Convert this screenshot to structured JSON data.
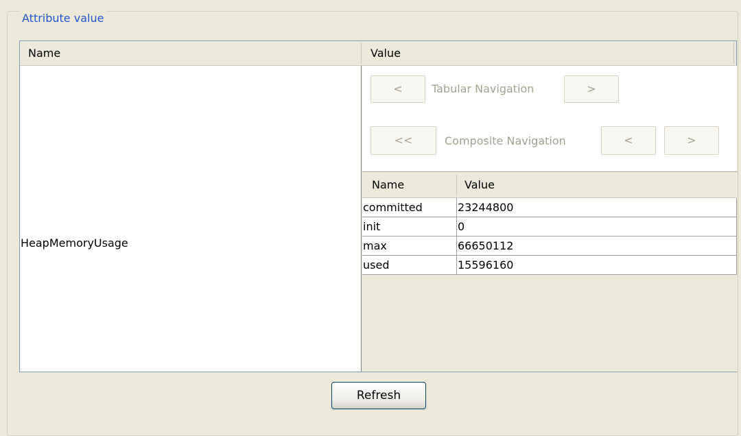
{
  "panel": {
    "legend": "Attribute value"
  },
  "table": {
    "headers": {
      "name": "Name",
      "value": "Value"
    },
    "attribute_name": "HeapMemoryUsage"
  },
  "tabular_nav": {
    "prev": "<",
    "label": "Tabular Navigation",
    "next": ">"
  },
  "composite_nav": {
    "first": "<<",
    "label": "Composite Navigation",
    "prev": "<",
    "next": ">"
  },
  "composite_table": {
    "headers": {
      "name": "Name",
      "value": "Value"
    },
    "rows": [
      {
        "name": "committed",
        "value": "23244800"
      },
      {
        "name": "init",
        "value": "0"
      },
      {
        "name": "max",
        "value": "66650112"
      },
      {
        "name": "used",
        "value": "15596160"
      }
    ]
  },
  "actions": {
    "refresh": "Refresh"
  }
}
